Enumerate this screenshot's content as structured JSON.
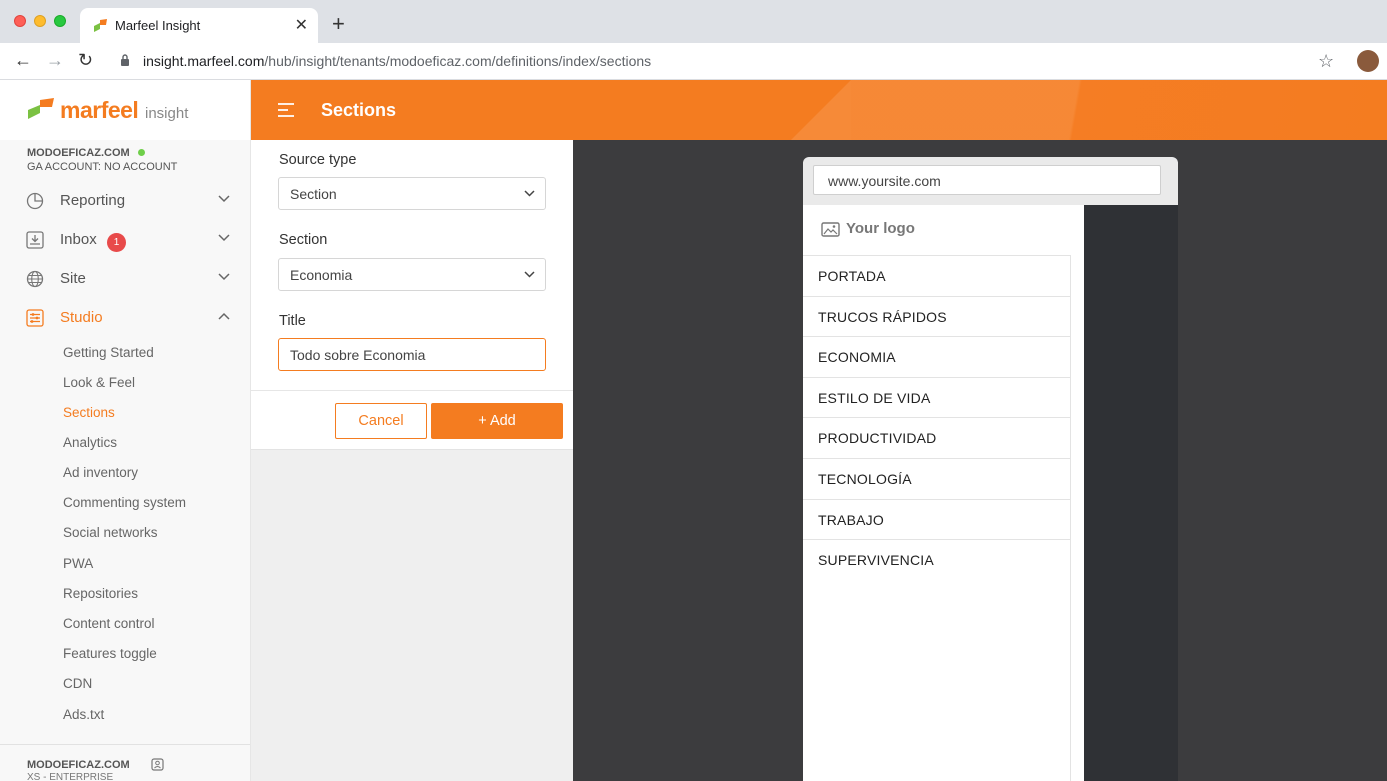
{
  "browser": {
    "tab_title": "Marfeel Insight",
    "url_host": "insight.marfeel.com",
    "url_path": "/hub/insight/tenants/modoeficaz.com/definitions/index/sections"
  },
  "brand": {
    "name": "marfeel",
    "product": "insight",
    "accent": "#f47c20"
  },
  "account": {
    "name": "MODOEFICAZ.COM",
    "ga": "GA ACCOUNT: NO ACCOUNT"
  },
  "sidebar": {
    "nav": [
      {
        "label": "Reporting"
      },
      {
        "label": "Inbox",
        "badge": "1"
      },
      {
        "label": "Site"
      },
      {
        "label": "Studio"
      }
    ],
    "studio_items": [
      {
        "label": "Getting Started"
      },
      {
        "label": "Look & Feel"
      },
      {
        "label": "Sections"
      },
      {
        "label": "Analytics"
      },
      {
        "label": "Ad inventory"
      },
      {
        "label": "Commenting system"
      },
      {
        "label": "Social networks"
      },
      {
        "label": "PWA"
      },
      {
        "label": "Repositories"
      },
      {
        "label": "Content control"
      },
      {
        "label": "Features toggle"
      },
      {
        "label": "CDN"
      },
      {
        "label": "Ads.txt"
      }
    ],
    "footer": {
      "account": "MODOEFICAZ.COM",
      "plan": "XS - ENTERPRISE"
    }
  },
  "header": {
    "title": "Sections"
  },
  "form": {
    "source_type": {
      "label": "Source type",
      "value": "Section"
    },
    "section": {
      "label": "Section",
      "value": "Economia"
    },
    "title": {
      "label": "Title",
      "value": "Todo sobre Economia"
    },
    "cancel_label": "Cancel",
    "add_label": "+ Add"
  },
  "preview": {
    "url": "www.yoursite.com",
    "logo_text": "Your logo",
    "menu": [
      "PORTADA",
      "TRUCOS RÁPIDOS",
      "ECONOMIA",
      "ESTILO DE VIDA",
      "PRODUCTIVIDAD",
      "TECNOLOGÍA",
      "TRABAJO",
      "SUPERVIVENCIA"
    ]
  }
}
